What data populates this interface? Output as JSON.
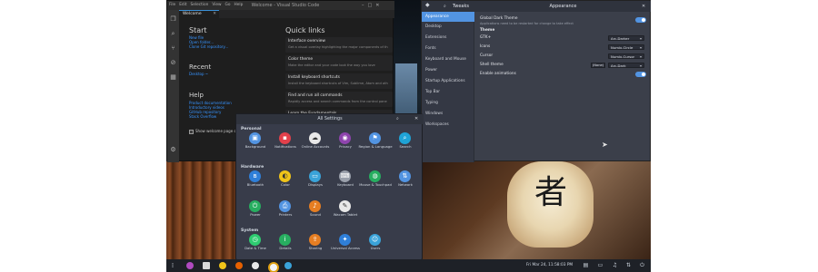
{
  "vscode": {
    "title": "Welcome - Visual Studio Code",
    "menu": [
      "File",
      "Edit",
      "Selection",
      "View",
      "Go",
      "Help"
    ],
    "tab": "Welcome",
    "start": {
      "heading": "Start",
      "links": [
        "New file",
        "Open folder...",
        "Clone Git repository..."
      ]
    },
    "recent": {
      "heading": "Recent",
      "items": [
        "Desktop  ~"
      ]
    },
    "help": {
      "heading": "Help",
      "links": [
        "Product documentation",
        "Introductory videos",
        "GitHub repository",
        "Stack Overflow"
      ]
    },
    "quick_links": {
      "heading": "Quick links",
      "cards": [
        {
          "title": "Interface overview",
          "desc": "Get a visual overlay highlighting the major components of th"
        },
        {
          "title": "Color theme",
          "desc": "Make the editor and your code look the way you love"
        },
        {
          "title": "Install keyboard shortcuts",
          "desc": "Install the keyboard shortcuts of Vim, Sublime, Atom and oth"
        },
        {
          "title": "Find and run all commands",
          "desc": "Rapidly access and search commands from the control pane"
        },
        {
          "title": "Learn the Fundamentals",
          "desc": ""
        }
      ]
    },
    "show_welcome": "Show welcome page on startup"
  },
  "tweaks": {
    "app_title": "Tweaks",
    "panel_title": "Appearance",
    "sidebar": [
      "Appearance",
      "Desktop",
      "Extensions",
      "Fonts",
      "Keyboard and Mouse",
      "Power",
      "Startup Applications",
      "Top Bar",
      "Typing",
      "Windows",
      "Workspaces"
    ],
    "global_dark": {
      "label": "Global Dark Theme",
      "sub": "Applications need to be restarted for change to take effect",
      "on": true
    },
    "theme_heading": "Theme",
    "rows": [
      {
        "label": "GTK+",
        "value": "Arc-Darker"
      },
      {
        "label": "Icons",
        "value": "Numix-Circle"
      },
      {
        "label": "Cursor",
        "value": "Numix-Cursor"
      },
      {
        "label": "Shell theme",
        "value": "Arc-Dark",
        "extra": "(None)"
      }
    ],
    "animations": {
      "label": "Enable animations",
      "on": true
    }
  },
  "settings": {
    "title": "All Settings",
    "sections": [
      {
        "name": "Personal",
        "items": [
          {
            "label": "Background",
            "color": "#5294e2",
            "glyph": "▣"
          },
          {
            "label": "Notifications",
            "color": "#e2404b",
            "glyph": "▪"
          },
          {
            "label": "Online Accounts",
            "color": "#e8e8e8",
            "glyph": "☁"
          },
          {
            "label": "Privacy",
            "color": "#8e44ad",
            "glyph": "◉"
          },
          {
            "label": "Region & Language",
            "color": "#5294e2",
            "glyph": "⚑"
          },
          {
            "label": "Search",
            "color": "#1fa3d6",
            "glyph": "⌕"
          }
        ]
      },
      {
        "name": "Hardware",
        "items": [
          {
            "label": "Bluetooth",
            "color": "#2f7fd8",
            "glyph": "ʙ"
          },
          {
            "label": "Color",
            "color": "#f0c419",
            "glyph": "◐"
          },
          {
            "label": "Displays",
            "color": "#3aa3d9",
            "glyph": "▭"
          },
          {
            "label": "Keyboard",
            "color": "#9aa0ab",
            "glyph": "⌨"
          },
          {
            "label": "Mouse & Touchpad",
            "color": "#27ae60",
            "glyph": "◍"
          },
          {
            "label": "Network",
            "color": "#5294e2",
            "glyph": "⇅"
          },
          {
            "label": "Power",
            "color": "#27ae60",
            "glyph": "⏻"
          },
          {
            "label": "Printers",
            "color": "#5294e2",
            "glyph": "⎙"
          },
          {
            "label": "Sound",
            "color": "#e67e22",
            "glyph": "♪"
          },
          {
            "label": "Wacom Tablet",
            "color": "#e8e8e8",
            "glyph": "✎"
          }
        ]
      },
      {
        "name": "System",
        "items": [
          {
            "label": "Date & Time",
            "color": "#2ecc71",
            "glyph": "◷"
          },
          {
            "label": "Details",
            "color": "#27ae60",
            "glyph": "i"
          },
          {
            "label": "Sharing",
            "color": "#e67e22",
            "glyph": "⇪"
          },
          {
            "label": "Universal Access",
            "color": "#2f7fd8",
            "glyph": "✦"
          },
          {
            "label": "Users",
            "color": "#3aa3d9",
            "glyph": "☺"
          }
        ]
      }
    ]
  },
  "taskbar": {
    "clock": "Fri Mar 24, 11:58:03 PM"
  },
  "wallpaper": {
    "lantern_glyph": "者"
  }
}
